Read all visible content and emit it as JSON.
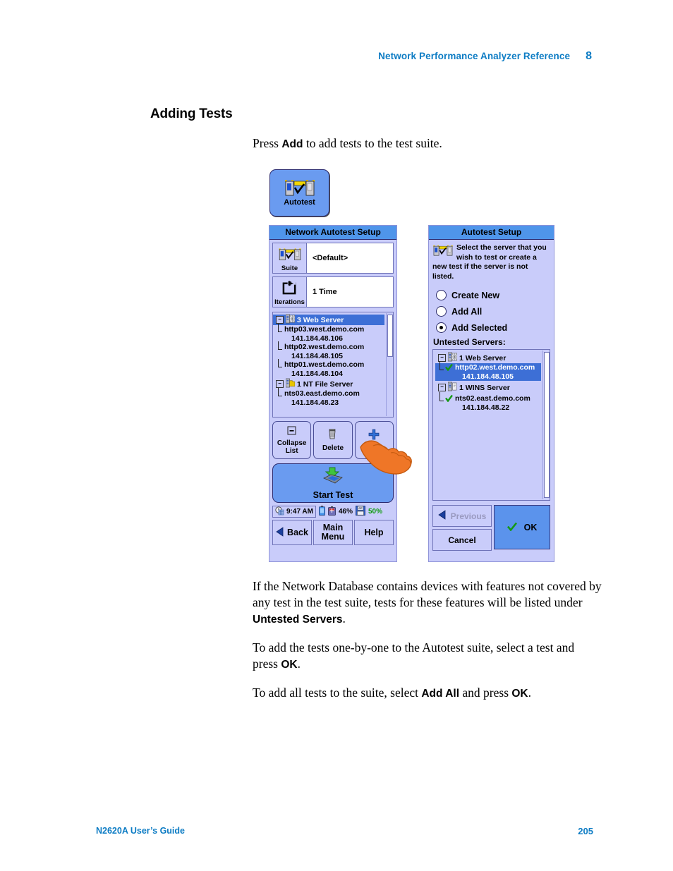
{
  "header": {
    "title": "Network Performance Analyzer Reference",
    "chapter": "8"
  },
  "heading": "Adding Tests",
  "intro": {
    "pre": "Press ",
    "bold": "Add",
    "post": " to add tests to the test suite."
  },
  "paragraphs": [
    {
      "a": "If the Network Database contains devices with features not covered by any test in the test suite, tests for these features will be listed under ",
      "b": "Untested Servers",
      "c": "."
    },
    {
      "a": "To add the tests one-by-one to the Autotest suite, select a test and press ",
      "b": "OK",
      "c": "."
    },
    {
      "a": "To add all tests to the suite, select ",
      "b": "Add All",
      "c": " and press ",
      "b2": "OK",
      "c2": "."
    }
  ],
  "footer": {
    "left": "N2620A User’s Guide",
    "right": "205"
  },
  "autotest_button": {
    "label": "Autotest",
    "icon": "autotest-icon"
  },
  "left_panel": {
    "title": "Network Autotest Setup",
    "fields": [
      {
        "button_label": "Suite",
        "icon": "autotest-icon",
        "value": "<Default>"
      },
      {
        "button_label": "Iterations",
        "icon": "iterations-icon",
        "value": "1 Time"
      }
    ],
    "tree": [
      {
        "type": "group",
        "expander": "−",
        "icon": "web-server-icon",
        "label": "3 Web Server",
        "selected": true
      },
      {
        "type": "leaf",
        "name": "http03.west.demo.com",
        "ip": "141.184.48.106"
      },
      {
        "type": "leaf",
        "name": "http02.west.demo.com",
        "ip": "141.184.48.105"
      },
      {
        "type": "leaf",
        "name": "http01.west.demo.com",
        "ip": "141.184.48.104"
      },
      {
        "type": "group",
        "expander": "−",
        "icon": "nt-file-server-icon",
        "label": "1 NT File Server",
        "selected": false
      },
      {
        "type": "leaf",
        "name": "nts03.east.demo.com",
        "ip": "141.184.48.23"
      }
    ],
    "buttons": [
      {
        "icon": "collapse-icon",
        "label": "Collapse List"
      },
      {
        "icon": "trash-icon",
        "label": "Delete"
      },
      {
        "icon": "plus-icon",
        "label": "Add"
      }
    ],
    "start_test": {
      "label": "Start Test",
      "icon": "start-test-icon"
    },
    "status": {
      "time": "9:47 AM",
      "battery": "46%",
      "storage": "50%"
    },
    "bottom_buttons": [
      {
        "label": "Back",
        "icon": "back-arrow-icon"
      },
      {
        "label": "Main Menu"
      },
      {
        "label": "Help"
      }
    ]
  },
  "right_panel": {
    "title": "Autotest Setup",
    "instruction": "Select the server that you wish to test or create a new test if the server is not listed.",
    "options": [
      {
        "label": "Create New",
        "selected": false
      },
      {
        "label": "Add All",
        "selected": false
      },
      {
        "label": "Add Selected",
        "selected": true
      }
    ],
    "untested_label": "Untested Servers:",
    "tree": [
      {
        "type": "group",
        "expander": "−",
        "icon": "web-server-icon",
        "label": "1 Web Server"
      },
      {
        "type": "leaf",
        "check": true,
        "name": "http02.west.demo.com",
        "ip": "141.184.48.105",
        "selected": true
      },
      {
        "type": "group",
        "expander": "−",
        "icon": "wins-server-icon",
        "label": "1 WINS Server"
      },
      {
        "type": "leaf",
        "check": true,
        "name": "nts02.east.demo.com",
        "ip": "141.184.48.22",
        "selected": false
      }
    ],
    "previous_label": "Previous",
    "cancel_label": "Cancel",
    "ok_label": "OK"
  },
  "cursor": {
    "type": "hand-pointer"
  },
  "colors": {
    "accent_blue": "#0d7cc4",
    "titlebar_blue": "#4f95ea",
    "panel_lavender": "#c9ccfa",
    "selection_blue": "#3d6fd6",
    "button_blue": "#6a9bf0",
    "check_green": "#159915",
    "cursor_orange": "#ef7627"
  }
}
